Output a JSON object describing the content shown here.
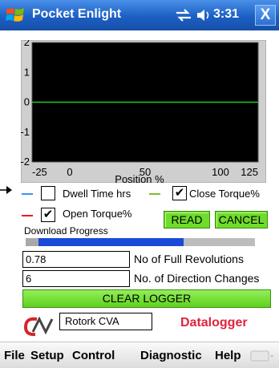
{
  "titlebar": {
    "app_title": "Pocket Enlight",
    "clock": "3:31",
    "close_label": "X"
  },
  "chart_data": {
    "type": "line",
    "xlabel": "Position %",
    "ylabel": "",
    "xlim": [
      -25,
      125
    ],
    "ylim": [
      -2,
      2
    ],
    "x_ticks": [
      "-25",
      "0",
      "50",
      "100",
      "125"
    ],
    "x_tick_values": [
      -25,
      0,
      50,
      100,
      125
    ],
    "y_ticks": [
      "2",
      "1",
      "0",
      "-1",
      "-2"
    ],
    "y_tick_values": [
      2,
      1,
      0,
      -1,
      -2
    ],
    "background": "#000000",
    "frame_color": "#c9c9c9",
    "series": [
      {
        "color": "#27c52a",
        "x": [
          -25,
          125
        ],
        "y": [
          0,
          0
        ]
      }
    ]
  },
  "options": {
    "dwell_label": "Dwell Time hrs",
    "dwell_checked": false,
    "dwell_color": "#3f8ff0",
    "close_label": "Close Torque%",
    "close_checked": true,
    "close_color": "#7ac030",
    "open_label": "Open Torque%",
    "open_checked": true,
    "open_color": "#e02020",
    "check_mark": "✔"
  },
  "buttons": {
    "read": "READ",
    "cancel": "CANCEL",
    "clear_logger": "CLEAR LOGGER"
  },
  "download": {
    "label": "Download Progress",
    "progress": 0.69
  },
  "stats": {
    "full_rev_value": "0.78",
    "full_rev_label": "No of Full Revolutions",
    "dir_changes_value": "6",
    "dir_changes_label": "No. of Direction Changes"
  },
  "footer": {
    "device": "Rotork CVA",
    "datalogger": "Datalogger"
  },
  "menu": {
    "items": [
      "File",
      "Setup",
      "Control",
      "Diagnostic",
      "Help"
    ]
  }
}
